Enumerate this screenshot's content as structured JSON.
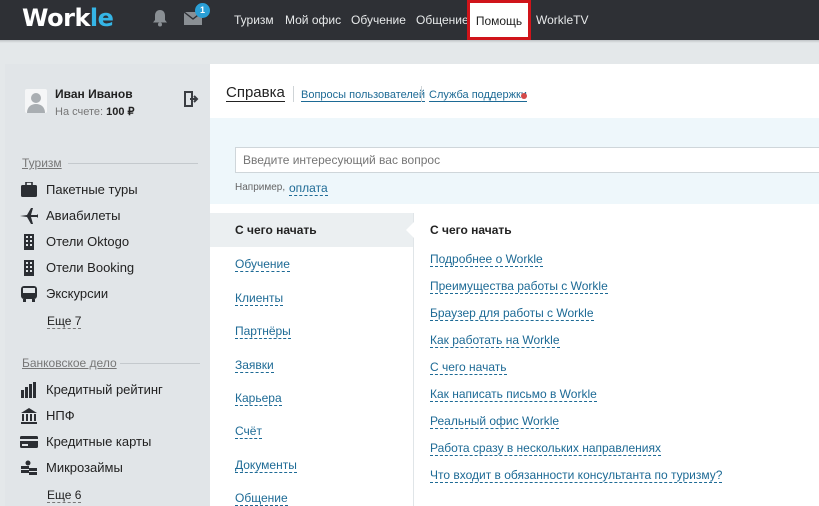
{
  "header": {
    "logo_main": "Work",
    "logo_accent": "le",
    "mail_badge": "1",
    "nav": [
      "Туризм",
      "Мой офис",
      "Обучение",
      "Общение",
      "Помощь",
      "WorkleTV"
    ],
    "active_nav": "Помощь"
  },
  "user": {
    "name": "Иван Иванов",
    "balance_label": "На счете:",
    "balance_value": "100 ₽"
  },
  "sidebar": {
    "tourism_title": "Туризм",
    "tourism_items": [
      "Пакетные туры",
      "Авиабилеты",
      "Отели Oktogo",
      "Отели Booking",
      "Экскурсии"
    ],
    "tourism_more": "Еще 7",
    "banking_title": "Банковское дело",
    "banking_items": [
      "Кредитный рейтинг",
      "НПФ",
      "Кредитные карты",
      "Микрозаймы"
    ],
    "banking_more": "Еще 6"
  },
  "page": {
    "title": "Справка",
    "links": [
      "Вопросы пользователей",
      "Служба поддержки"
    ]
  },
  "search": {
    "placeholder": "Введите интересующий вас вопрос",
    "example_label": "Например,",
    "example_value": "оплата"
  },
  "categories": {
    "active": "С чего начать",
    "items": [
      "Обучение",
      "Клиенты",
      "Партнёры",
      "Заявки",
      "Карьера",
      "Счёт",
      "Документы",
      "Общение"
    ]
  },
  "questions": {
    "title": "С чего начать",
    "items": [
      "Подробнее о Workle",
      "Преимущества работы с Workle",
      "Браузер для работы с Workle",
      "Как работать на Workle",
      "С чего начать",
      "Как написать письмо в Workle",
      "Реальный офис Workle",
      "Работа сразу в нескольких направлениях",
      "Что входит в обязанности консультанта по туризму?"
    ]
  },
  "colors": {
    "topbar": "#2e3035",
    "accent": "#35b5e6",
    "link": "#1d6a95",
    "highlight": "#d0141a"
  }
}
